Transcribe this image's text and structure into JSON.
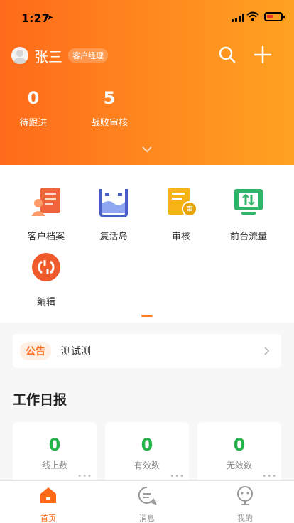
{
  "status_bar": {
    "time": "1:27",
    "location_glyph": "➤"
  },
  "header": {
    "user_name": "张三",
    "role_tag": "客户经理",
    "icons": [
      "avatar",
      "search-icon",
      "plus-icon"
    ],
    "stats": [
      {
        "value": "0",
        "label": "待跟进"
      },
      {
        "value": "5",
        "label": "战败审核"
      }
    ],
    "gradient": [
      "#ff6a1a",
      "#ffa221"
    ]
  },
  "menu": {
    "items": [
      {
        "label": "客户档案",
        "icon": "customer-file-icon"
      },
      {
        "label": "复活岛",
        "icon": "island-icon"
      },
      {
        "label": "审核",
        "icon": "audit-icon"
      },
      {
        "label": "前台流量",
        "icon": "traffic-icon"
      },
      {
        "label": "编辑",
        "icon": "edit-icon"
      }
    ]
  },
  "notice": {
    "badge": "公告",
    "text": "测试测"
  },
  "daily_report": {
    "title": "工作日报",
    "cards": [
      {
        "value": "0",
        "label": "线上数"
      },
      {
        "value": "0",
        "label": "有效数"
      },
      {
        "value": "0",
        "label": "无效数"
      }
    ]
  },
  "tabbar": {
    "tabs": [
      {
        "label": "首页",
        "icon": "home-icon",
        "active": true
      },
      {
        "label": "消息",
        "icon": "message-icon",
        "active": false
      },
      {
        "label": "我的",
        "icon": "profile-icon",
        "active": false
      }
    ]
  },
  "colors": {
    "accent": "#ff6a1a",
    "green": "#22b34a"
  }
}
